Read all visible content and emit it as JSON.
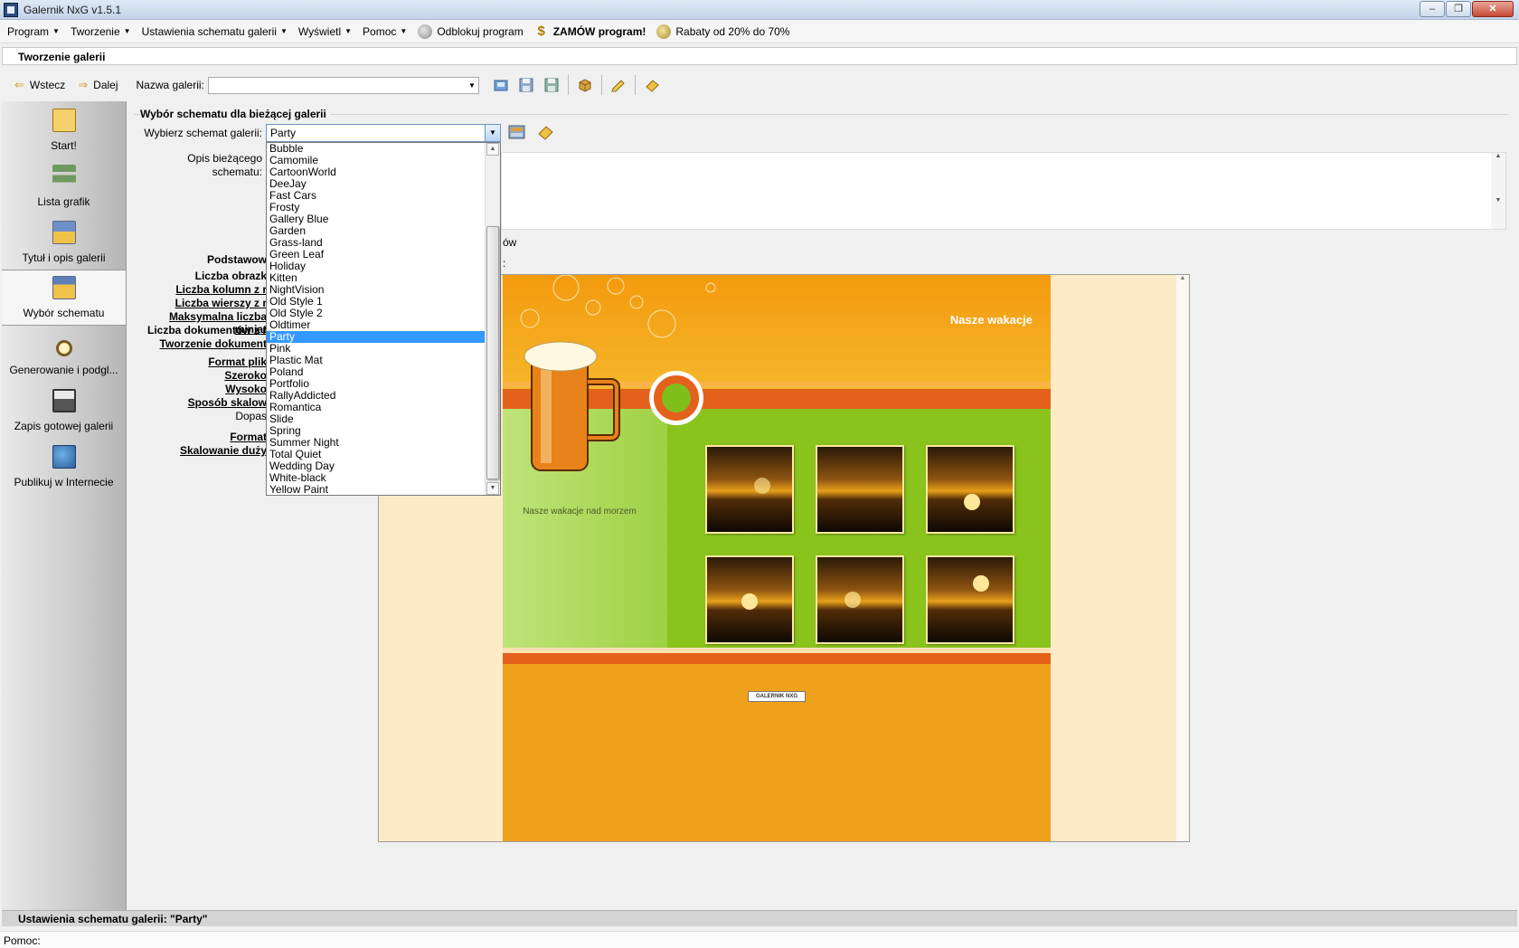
{
  "window": {
    "title": "Galernik NxG v1.5.1"
  },
  "menu": {
    "program": "Program",
    "tworzenie": "Tworzenie",
    "ustawienia": "Ustawienia schematu galerii",
    "wyswietl": "Wyświetl",
    "pomoc": "Pomoc",
    "odblokuj": "Odblokuj program",
    "zamow": "ZAMÓW program!",
    "rabaty": "Rabaty od 20% do 70%"
  },
  "section": {
    "title": "Tworzenie galerii"
  },
  "toolbar": {
    "back": "Wstecz",
    "next": "Dalej",
    "gallery_name_label": "Nazwa galerii:",
    "gallery_name_value": ""
  },
  "sidebar": {
    "items": [
      {
        "label": "Start!",
        "icon": "start-icon"
      },
      {
        "label": "Lista grafik",
        "icon": "list-icon"
      },
      {
        "label": "Tytuł i opis galerii",
        "icon": "folder-icon"
      },
      {
        "label": "Wybór schematu",
        "icon": "schema-icon"
      },
      {
        "label": "Generowanie i podgl...",
        "icon": "magnifier-icon"
      },
      {
        "label": "Zapis gotowej galerii",
        "icon": "floppy-icon"
      },
      {
        "label": "Publikuj w Internecie",
        "icon": "publish-icon"
      }
    ]
  },
  "schema": {
    "group_title": "Wybór schematu dla bieżącej galerii",
    "select_label": "Wybierz schemat galerii:",
    "selected": "Party",
    "desc_label_1": "Opis bieżącego",
    "desc_label_2": "schematu:",
    "options": [
      "Bubble",
      "Camomile",
      "CartoonWorld",
      "DeeJay",
      "Fast Cars",
      "Frosty",
      "Gallery Blue",
      "Garden",
      "Grass-land",
      "Green Leaf",
      "Holiday",
      "Kitten",
      "NightVision",
      "Old Style 1",
      "Old Style 2",
      "Oldtimer",
      "Party",
      "Pink",
      "Plastic Mat",
      "Poland",
      "Portfolio",
      "RallyAddicted",
      "Romantica",
      "Slide",
      "Spring",
      "Summer Night",
      "Total Quiet",
      "Wedding Day",
      "White-black",
      "Yellow Paint"
    ],
    "selected_index": 16
  },
  "settings_labels": {
    "podstawowe": "Podstawow",
    "liczba_obrazow": "Liczba obrazk",
    "liczba_kolumn": "Liczba kolumn z r",
    "liczba_wierszy": "Liczba wierszy z r",
    "maks_miniatur": "Maksymalna liczba miniat",
    "liczba_dokumentow": "Liczba dokumentów z r",
    "tworzenie_dokumentow": "Tworzenie dokument",
    "format_pliku": "Format plik",
    "szerokosc": "Szeroko",
    "wysokosc": "Wysoko",
    "sposob_skalowania": "Sposób skalow",
    "dopasuj": "Dopas",
    "format": "Format",
    "skalowanie_duzych": "Skalowanie duży",
    "partial_1": "ów",
    "partial_2": ":"
  },
  "preview": {
    "title": "Nasze wakacje",
    "caption": "Nasze wakacje nad morzem",
    "logo": "GALERNIK NXG"
  },
  "status": {
    "schema_settings": "Ustawienia schematu galerii: \"Party\"",
    "help": "Pomoc:"
  },
  "colors": {
    "selection": "#3399ff",
    "preview_orange": "#f1a91a",
    "preview_green": "#89c31c"
  }
}
